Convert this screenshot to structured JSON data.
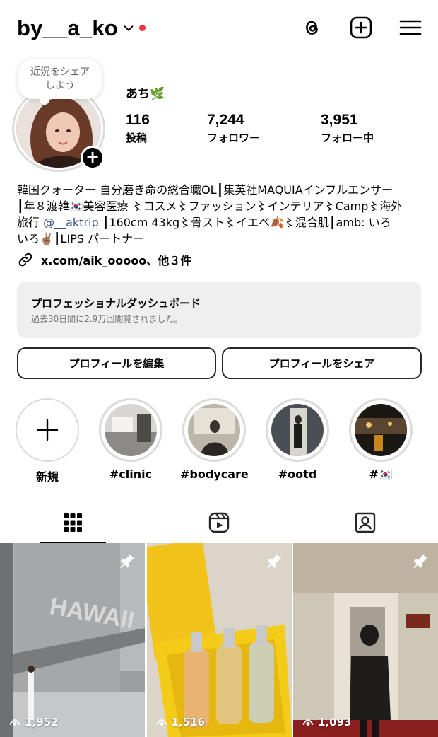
{
  "header": {
    "username": "by__a_ko",
    "icons": [
      "threads-icon",
      "new-post-icon",
      "menu-icon"
    ]
  },
  "profile": {
    "note": "近況をシェア\nしよう",
    "display_name": "あち🌿",
    "stats": [
      {
        "value": "116",
        "label": "投稿"
      },
      {
        "value": "7,244",
        "label": "フォロワー"
      },
      {
        "value": "3,951",
        "label": "フォロー中"
      }
    ],
    "bio_lines": [
      "韓国クォーター 自分磨き命の総合職OL┃集英社MAQUIAインフルエンサー",
      "┃年８渡韓🇰🇷美容医療 〻コスメ〻ファッション〻インテリア〻Camp〻海外",
      "旅行",
      "@__aktrip",
      "┃160cm 43kg〻骨スト〻イエベ🍂〻混合肌┃amb: いろ",
      "いろ✌🏽┃LIPS パートナー"
    ],
    "link": "x.com/aik_ooooo、他３件",
    "dashboard": {
      "title": "プロフェッショナルダッシュボード",
      "subtitle": "過去30日間に2.9万回閲覧されました。"
    },
    "buttons": {
      "edit": "プロフィールを編集",
      "share": "プロフィールをシェア"
    }
  },
  "highlights": [
    {
      "label": "新規"
    },
    {
      "label": "#clinic"
    },
    {
      "label": "#bodycare"
    },
    {
      "label": "#ootd"
    },
    {
      "label": "#🇰🇷"
    }
  ],
  "tabs": [
    "grid-icon",
    "reels-icon",
    "tagged-icon"
  ],
  "posts": [
    {
      "views": "1,952",
      "pinned": true
    },
    {
      "views": "1,516",
      "pinned": true
    },
    {
      "views": "1,093",
      "pinned": true
    }
  ],
  "colors": {
    "red_dot": "#ff3040",
    "mention": "#385185",
    "dashboard_bg": "#efefef"
  }
}
